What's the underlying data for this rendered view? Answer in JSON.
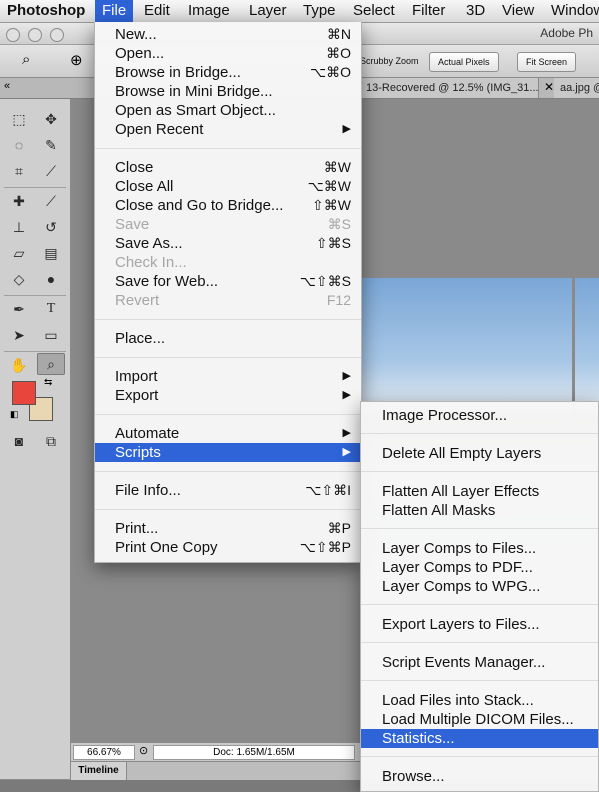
{
  "menubar": {
    "app": "Photoshop",
    "items": [
      "File",
      "Edit",
      "Image",
      "Layer",
      "Type",
      "Select",
      "Filter",
      "3D",
      "View",
      "Window"
    ]
  },
  "window": {
    "title": "Adobe Ph"
  },
  "options_bar": {
    "scrubby_zoom": "Scrubby Zoom",
    "actual_pixels": "Actual Pixels",
    "fit_screen": "Fit Screen"
  },
  "doc_tabs": [
    "13-Recovered @ 12.5% (IMG_31...",
    "aa.jpg @"
  ],
  "status": {
    "zoom": "66.67%",
    "doc": "Doc: 1.65M/1.65M"
  },
  "timeline": {
    "label": "Timeline"
  },
  "colors": {
    "foreground": "#e8453c",
    "background": "#e9d7b3",
    "highlight": "#2f64d9"
  },
  "file_menu": {
    "new": {
      "label": "New...",
      "shortcut": "⌘N"
    },
    "open": {
      "label": "Open...",
      "shortcut": "⌘O"
    },
    "browse_bridge": {
      "label": "Browse in Bridge...",
      "shortcut": "⌥⌘O"
    },
    "browse_mini_bridge": {
      "label": "Browse in Mini Bridge..."
    },
    "open_smart": {
      "label": "Open as Smart Object..."
    },
    "open_recent": {
      "label": "Open Recent"
    },
    "close": {
      "label": "Close",
      "shortcut": "⌘W"
    },
    "close_all": {
      "label": "Close All",
      "shortcut": "⌥⌘W"
    },
    "close_go_bridge": {
      "label": "Close and Go to Bridge...",
      "shortcut": "⇧⌘W"
    },
    "save": {
      "label": "Save",
      "shortcut": "⌘S"
    },
    "save_as": {
      "label": "Save As...",
      "shortcut": "⇧⌘S"
    },
    "check_in": {
      "label": "Check In..."
    },
    "save_web": {
      "label": "Save for Web...",
      "shortcut": "⌥⇧⌘S"
    },
    "revert": {
      "label": "Revert",
      "shortcut": "F12"
    },
    "place": {
      "label": "Place..."
    },
    "import": {
      "label": "Import"
    },
    "export": {
      "label": "Export"
    },
    "automate": {
      "label": "Automate"
    },
    "scripts": {
      "label": "Scripts"
    },
    "file_info": {
      "label": "File Info...",
      "shortcut": "⌥⇧⌘I"
    },
    "print": {
      "label": "Print...",
      "shortcut": "⌘P"
    },
    "print_one": {
      "label": "Print One Copy",
      "shortcut": "⌥⇧⌘P"
    }
  },
  "scripts_menu": [
    "Image Processor...",
    "Delete All Empty Layers",
    "Flatten All Layer Effects",
    "Flatten All Masks",
    "Layer Comps to Files...",
    "Layer Comps to PDF...",
    "Layer Comps to WPG...",
    "Export Layers to Files...",
    "Script Events Manager...",
    "Load Files into Stack...",
    "Load Multiple DICOM Files...",
    "Statistics...",
    "Browse..."
  ]
}
